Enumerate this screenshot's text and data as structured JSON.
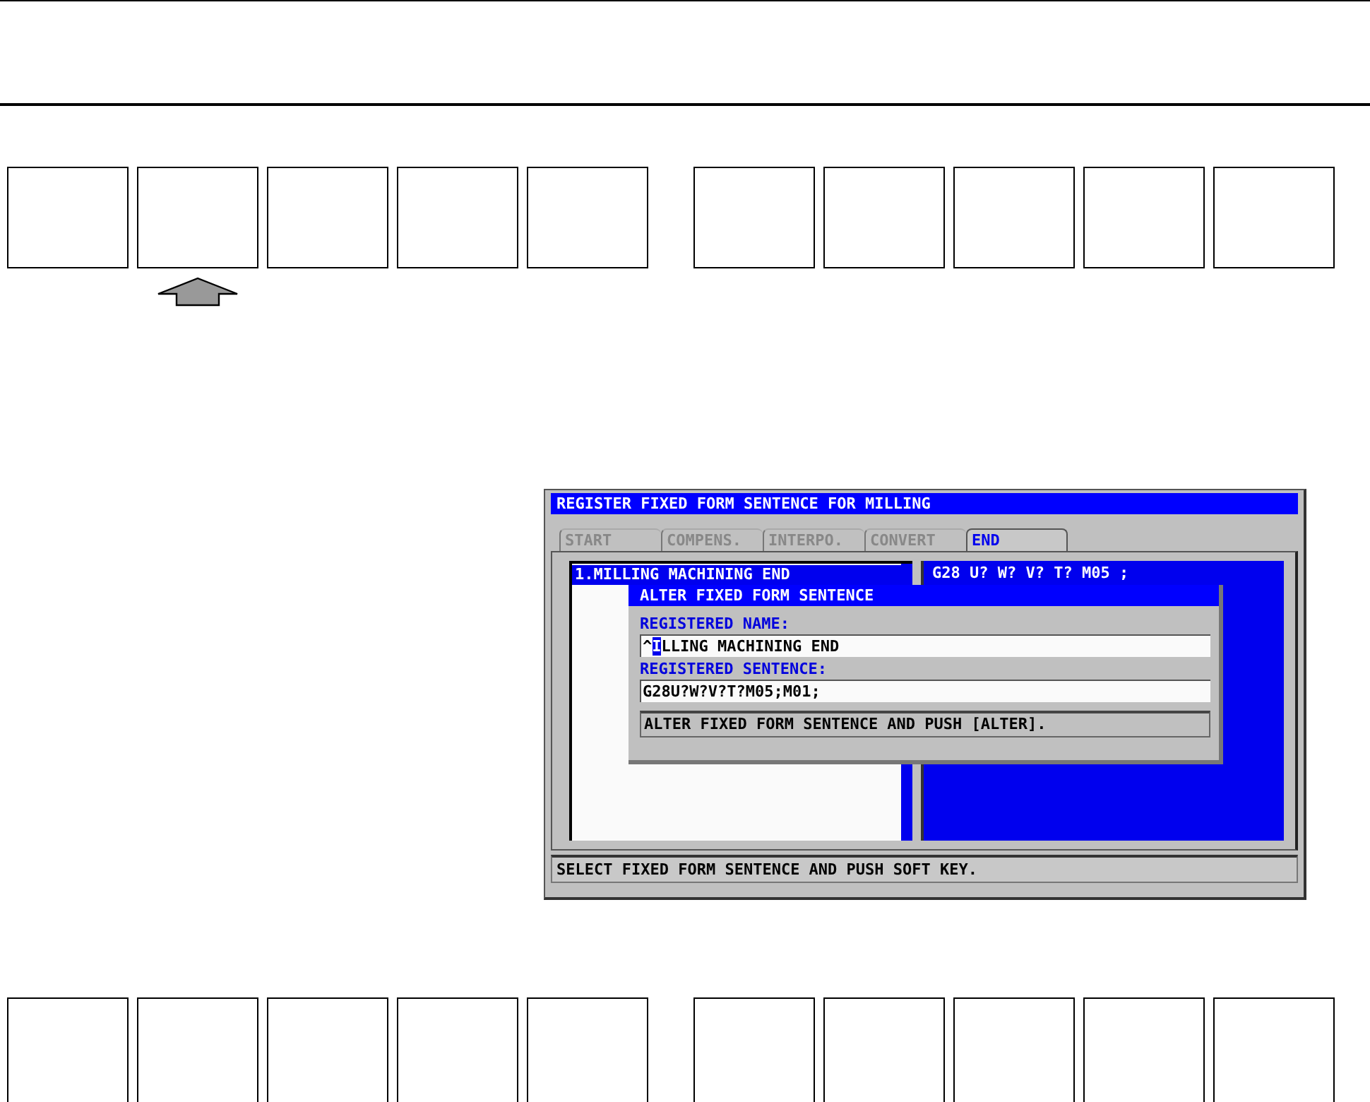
{
  "soft_keys_top": [
    {
      "pressed": false
    },
    {
      "pressed": true
    },
    {
      "pressed": false
    },
    {
      "pressed": false
    },
    {
      "pressed": false
    },
    {
      "pressed": false
    },
    {
      "pressed": false
    },
    {
      "pressed": false
    },
    {
      "pressed": false
    },
    {
      "pressed": false
    }
  ],
  "screen": {
    "title": "REGISTER FIXED FORM SENTENCE FOR MILLING",
    "tabs": [
      {
        "label": "START",
        "selected": false
      },
      {
        "label": "COMPENS.",
        "selected": false
      },
      {
        "label": "INTERPO.",
        "selected": false
      },
      {
        "label": "CONVERT",
        "selected": false
      },
      {
        "label": "END",
        "selected": true
      }
    ],
    "list": [
      {
        "label": "1.MILLING MACHINING END",
        "selected": true
      }
    ],
    "preview": "G28 U? W? V? T? M05 ;",
    "dialog": {
      "title": "ALTER FIXED FORM SENTENCE",
      "fields": [
        {
          "label": "REGISTERED NAME:",
          "value_before_cursor": "^",
          "cursor_char": "I",
          "value_after_cursor": "LLING MACHINING END"
        },
        {
          "label": "REGISTERED SENTENCE:",
          "value_before_cursor": "G28U?W?V?T?M05;M01;"
        }
      ],
      "message": "ALTER FIXED FORM SENTENCE AND PUSH [ALTER]."
    },
    "status": "SELECT FIXED FORM SENTENCE AND PUSH SOFT KEY."
  },
  "soft_keys_bottom": [
    {
      "pressed": false
    },
    {
      "pressed": false
    },
    {
      "pressed": false
    },
    {
      "pressed": false
    },
    {
      "pressed": false
    },
    {
      "pressed": false
    },
    {
      "pressed": false
    },
    {
      "pressed": false
    },
    {
      "pressed": false
    },
    {
      "pressed": false
    }
  ]
}
